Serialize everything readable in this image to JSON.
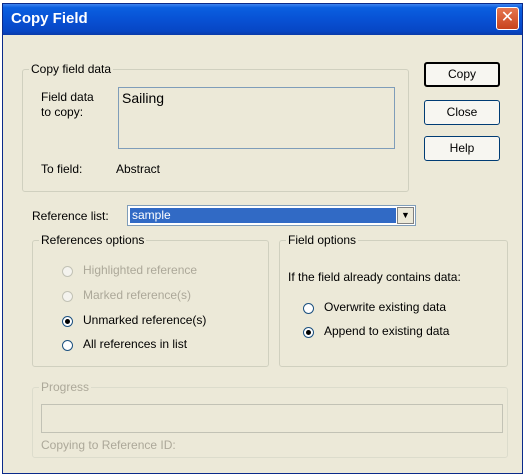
{
  "window": {
    "title": "Copy Field",
    "close_glyph": "✕"
  },
  "copy_field_data": {
    "legend": "Copy field data",
    "field_data_label_1": "Field data",
    "field_data_label_2": "to copy:",
    "field_data_value": "Sailing",
    "to_field_label": "To field:",
    "to_field_value": "Abstract"
  },
  "buttons": {
    "copy": "Copy",
    "close": "Close",
    "help": "Help"
  },
  "reference_list": {
    "label": "Reference list:",
    "selected": "sample",
    "arrow": "▼"
  },
  "references_options": {
    "legend": "References options",
    "items": [
      {
        "label": "Highlighted reference",
        "checked": false,
        "enabled": false
      },
      {
        "label": "Marked reference(s)",
        "checked": false,
        "enabled": false
      },
      {
        "label": "Unmarked reference(s)",
        "checked": true,
        "enabled": true
      },
      {
        "label": "All references in list",
        "checked": false,
        "enabled": true
      }
    ]
  },
  "field_options": {
    "legend": "Field options",
    "prompt": "If the field already contains data:",
    "items": [
      {
        "label": "Overwrite existing data",
        "checked": false
      },
      {
        "label": "Append to existing data",
        "checked": true
      }
    ]
  },
  "progress": {
    "legend": "Progress",
    "status_label": "Copying to Reference ID:"
  }
}
